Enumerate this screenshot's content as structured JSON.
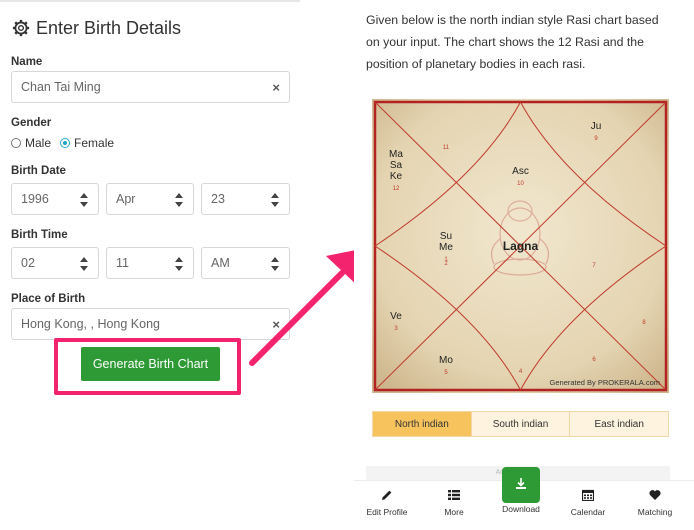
{
  "form": {
    "title": "Enter Birth Details",
    "name_label": "Name",
    "name_value": "Chan Tai Ming",
    "gender_label": "Gender",
    "gender_options": [
      "Male",
      "Female"
    ],
    "gender_selected": "Female",
    "birth_date_label": "Birth Date",
    "birth_date": {
      "year": "1996",
      "month": "Apr",
      "day": "23"
    },
    "birth_time_label": "Birth Time",
    "birth_time": {
      "hour": "02",
      "minute": "11",
      "ampm": "AM"
    },
    "place_label": "Place of Birth",
    "place_value": "Hong Kong, , Hong Kong",
    "clear_symbol": "×",
    "generate_label": "Generate Birth Chart"
  },
  "description": "Given below is the north indian style Rasi chart based on your input. The chart shows the 12 Rasi and the position of planetary bodies in each rasi.",
  "chart": {
    "center_label": "Lagna",
    "watermark": "Generated By PROKERALA.com",
    "houses": [
      {
        "rasi": "10",
        "planets": [
          "Asc"
        ]
      },
      {
        "rasi": "11",
        "planets": []
      },
      {
        "rasi": "12",
        "planets": [
          "Ma",
          "Sa",
          "Ke"
        ]
      },
      {
        "rasi": "1",
        "planets": [
          "Su",
          "Me"
        ]
      },
      {
        "rasi": "2",
        "planets": []
      },
      {
        "rasi": "3",
        "planets": [
          "Ve"
        ]
      },
      {
        "rasi": "4",
        "planets": []
      },
      {
        "rasi": "5",
        "planets": [
          "Mo"
        ]
      },
      {
        "rasi": "6",
        "planets": []
      },
      {
        "rasi": "7",
        "planets": []
      },
      {
        "rasi": "8",
        "planets": []
      },
      {
        "rasi": "9",
        "planets": [
          "Ju"
        ]
      }
    ],
    "border_color": "#b22222",
    "bg_color": "#e9dcc0"
  },
  "style_tabs": [
    "North indian",
    "South indian",
    "East indian"
  ],
  "ad_label": "Advertisement",
  "bottom_nav": {
    "items": [
      {
        "label": "Edit Profile",
        "icon": "pencil-icon"
      },
      {
        "label": "More",
        "icon": "list-icon"
      },
      {
        "label": "Download",
        "icon": "download-icon"
      },
      {
        "label": "Calendar",
        "icon": "calendar-icon"
      },
      {
        "label": "Matching",
        "icon": "heart-icon"
      }
    ]
  },
  "colors": {
    "accent_green": "#2e9a36",
    "highlight_pink": "#f3236d",
    "tab_active": "#f6c35d"
  }
}
